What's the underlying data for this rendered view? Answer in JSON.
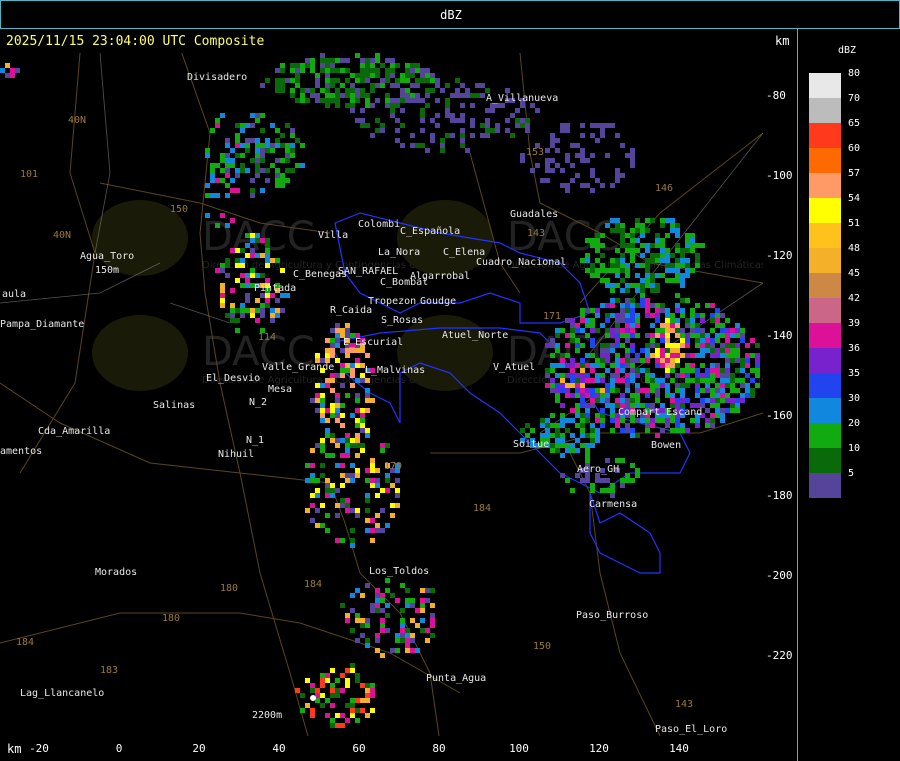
{
  "header": {
    "title": "dBZ",
    "timestamp": "2025/11/15 23:04:00 UTC Composite",
    "km_unit": "km"
  },
  "axes": {
    "y_ticks": [
      "-80",
      "-100",
      "-120",
      "-140",
      "-160",
      "-180",
      "-200",
      "-220"
    ],
    "x_ticks": [
      "-20",
      "0",
      "20",
      "40",
      "60",
      "80",
      "100",
      "120",
      "140"
    ]
  },
  "legend": {
    "title": "dBZ",
    "entries": [
      {
        "label": "80",
        "color": "#e8e8e8"
      },
      {
        "label": "70",
        "color": "#bcbcbc"
      },
      {
        "label": "65",
        "color": "#ff3a1c"
      },
      {
        "label": "60",
        "color": "#ff6a00"
      },
      {
        "label": "57",
        "color": "#ff9a66"
      },
      {
        "label": "54",
        "color": "#ffff00"
      },
      {
        "label": "51",
        "color": "#ffc21c"
      },
      {
        "label": "48",
        "color": "#f5b02a"
      },
      {
        "label": "45",
        "color": "#cc8844"
      },
      {
        "label": "42",
        "color": "#cc6688"
      },
      {
        "label": "39",
        "color": "#dd1199"
      },
      {
        "label": "36",
        "color": "#7722cc"
      },
      {
        "label": "35",
        "color": "#2244ee"
      },
      {
        "label": "30",
        "color": "#1188dd"
      },
      {
        "label": "20",
        "color": "#11aa11"
      },
      {
        "label": "10",
        "color": "#0a6a0a"
      },
      {
        "label": "5",
        "color": "#554499"
      }
    ]
  },
  "places": [
    {
      "name": "Divisadero"
    },
    {
      "name": "A_Villanueva"
    },
    {
      "name": "Guadales"
    },
    {
      "name": "Agua_Toro"
    },
    {
      "name": "aula"
    },
    {
      "name": "Pampa_Diamante"
    },
    {
      "name": "Villa"
    },
    {
      "name": "Colombi"
    },
    {
      "name": "C_Española"
    },
    {
      "name": "La_Nora"
    },
    {
      "name": "C_Elena"
    },
    {
      "name": "Cuadro_Nacional"
    },
    {
      "name": "C_Benegas"
    },
    {
      "name": "SAN_RAFAEL"
    },
    {
      "name": "C_Bombal"
    },
    {
      "name": "Algarrobal"
    },
    {
      "name": "Pintada"
    },
    {
      "name": "Tropezon"
    },
    {
      "name": "Goudge"
    },
    {
      "name": "R_Caida"
    },
    {
      "name": "S_Rosas"
    },
    {
      "name": "Atuel_Norte"
    },
    {
      "name": "E_Escurial"
    },
    {
      "name": "Valle_Grande"
    },
    {
      "name": "L_Malvinas"
    },
    {
      "name": "V_Atuel"
    },
    {
      "name": "El_Desvio"
    },
    {
      "name": "Salinas"
    },
    {
      "name": "N_2"
    },
    {
      "name": "Cda_Amarilla"
    },
    {
      "name": "N_1"
    },
    {
      "name": "Nihuil"
    },
    {
      "name": "amentos"
    },
    {
      "name": "Soitue"
    },
    {
      "name": "Bowen"
    },
    {
      "name": "Aero_GH"
    },
    {
      "name": "Carmensa"
    },
    {
      "name": "Morados"
    },
    {
      "name": "Los_Toldos"
    },
    {
      "name": "Paso_Burroso"
    },
    {
      "name": "Punta_Agua"
    },
    {
      "name": "Lag_Llancanelo"
    },
    {
      "name": "Paso_El_Loro"
    },
    {
      "name": "Compart Escand"
    },
    {
      "name": "Mesa"
    },
    {
      "name": "Goudge"
    },
    {
      "name": "150m"
    },
    {
      "name": "2200m"
    }
  ],
  "route_labels": [
    "40N",
    "101",
    "40N",
    "150",
    "153",
    "146",
    "143",
    "171",
    "179",
    "184",
    "180",
    "184",
    "183",
    "184",
    "150",
    "143",
    "114",
    "180"
  ],
  "watermark": {
    "brand": "DACC",
    "subtitle": "Dirección de Agricultura y Contingencias Climáticas"
  }
}
